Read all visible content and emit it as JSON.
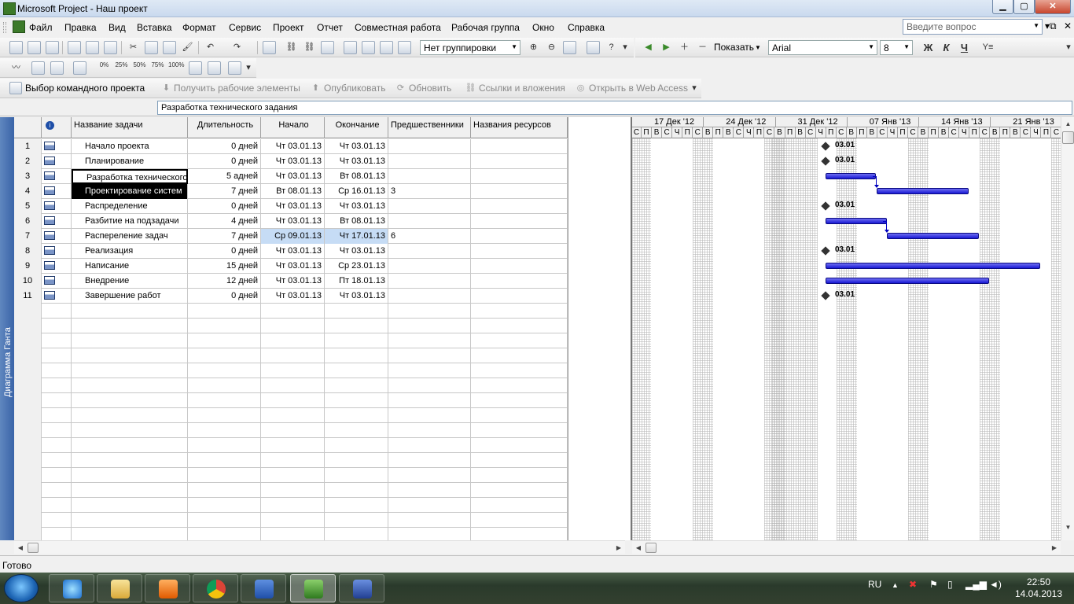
{
  "window": {
    "title": "Microsoft Project - Наш проект"
  },
  "menu": [
    "Файл",
    "Правка",
    "Вид",
    "Вставка",
    "Формат",
    "Сервис",
    "Проект",
    "Отчет",
    "Совместная работа",
    "Рабочая группа",
    "Окно",
    "Справка"
  ],
  "ask_placeholder": "Введите вопрос",
  "toolbar": {
    "grouping": "Нет группировки",
    "show": "Показать",
    "font": "Arial",
    "font_size": "8",
    "bold": "Ж",
    "italic": "К",
    "underline": "Ч",
    "percent_labels": [
      "0%",
      "25%",
      "50%",
      "75%",
      "100%"
    ]
  },
  "team_toolbar": {
    "choose": "Выбор командного проекта",
    "get_items": "Получить рабочие элементы",
    "publish": "Опубликовать",
    "refresh": "Обновить",
    "links": "Ссылки и вложения",
    "web_access": "Открыть в Web Access"
  },
  "edit_field": "Разработка технического задания",
  "view_label": "Диаграмма Ганта",
  "columns": [
    "Название задачи",
    "Длительность",
    "Начало",
    "Окончание",
    "Предшественники",
    "Названия ресурсов"
  ],
  "tasks": [
    {
      "id": "1",
      "name": "Начало проекта",
      "duration": "0 дней",
      "start": "Чт 03.01.13",
      "finish": "Чт 03.01.13",
      "pred": ""
    },
    {
      "id": "2",
      "name": "Планирование",
      "duration": "0 дней",
      "start": "Чт 03.01.13",
      "finish": "Чт 03.01.13",
      "pred": ""
    },
    {
      "id": "3",
      "name": "Разработка технического",
      "duration": "5 адней",
      "start": "Чт 03.01.13",
      "finish": "Вт 08.01.13",
      "pred": ""
    },
    {
      "id": "4",
      "name": "Проектирование систем",
      "duration": "7 дней",
      "start": "Вт 08.01.13",
      "finish": "Ср 16.01.13",
      "pred": "3"
    },
    {
      "id": "5",
      "name": "Распределение",
      "duration": "0 дней",
      "start": "Чт 03.01.13",
      "finish": "Чт 03.01.13",
      "pred": ""
    },
    {
      "id": "6",
      "name": "Разбитие на подзадачи",
      "duration": "4 дней",
      "start": "Чт 03.01.13",
      "finish": "Вт 08.01.13",
      "pred": ""
    },
    {
      "id": "7",
      "name": "Распереление задач",
      "duration": "7 дней",
      "start": "Ср 09.01.13",
      "finish": "Чт 17.01.13",
      "pred": "6"
    },
    {
      "id": "8",
      "name": "Реализация",
      "duration": "0 дней",
      "start": "Чт 03.01.13",
      "finish": "Чт 03.01.13",
      "pred": ""
    },
    {
      "id": "9",
      "name": "Написание",
      "duration": "15 дней",
      "start": "Чт 03.01.13",
      "finish": "Ср 23.01.13",
      "pred": ""
    },
    {
      "id": "10",
      "name": "Внедрение",
      "duration": "12 дней",
      "start": "Чт 03.01.13",
      "finish": "Пт 18.01.13",
      "pred": ""
    },
    {
      "id": "11",
      "name": "Завершение работ",
      "duration": "0 дней",
      "start": "Чт 03.01.13",
      "finish": "Чт 03.01.13",
      "pred": ""
    }
  ],
  "gantt": {
    "weeks": [
      "17 Дек '12",
      "24 Дек '12",
      "31 Дек '12",
      "07 Янв '13",
      "14 Янв '13",
      "21 Янв '13"
    ],
    "day_letters": [
      "П",
      "В",
      "С",
      "Ч",
      "П",
      "С",
      "В"
    ],
    "first_day": "С",
    "milestone_label": "03.01"
  },
  "status": "Готово",
  "tray": {
    "lang": "RU",
    "time": "22:50",
    "date": "14.04.2013"
  }
}
